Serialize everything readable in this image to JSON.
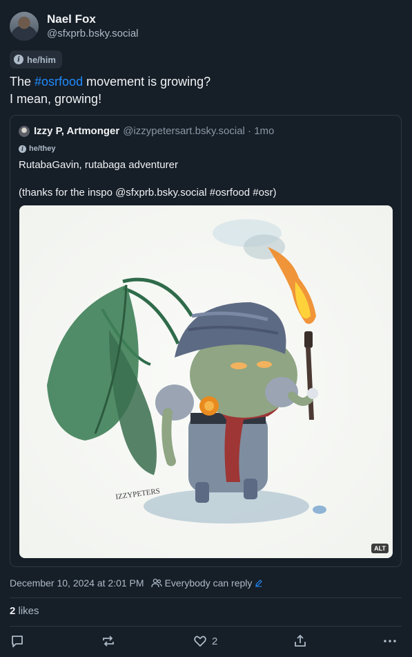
{
  "author": {
    "display_name": "Nael Fox",
    "handle": "@sfxprb.bsky.social",
    "pronouns": "he/him"
  },
  "post": {
    "text_before": "The ",
    "hashtag": "#osrfood",
    "text_after": " movement is growing?",
    "line2": "I mean, growing!"
  },
  "quote": {
    "display_name": "Izzy P, Artmonger",
    "handle_time": "@izzypetersart.bsky.social · 1mo",
    "pronouns": "he/they",
    "line1": "RutabaGavin, rutabaga adventurer",
    "line2": "",
    "line3": "(thanks for the inspo @sfxprb.bsky.social #osrfood #osr)",
    "image_alt_badge": "ALT",
    "signature": "IZZYPETERS"
  },
  "meta": {
    "timestamp": "December 10, 2024 at 2:01 PM",
    "reply_setting": "Everybody can reply"
  },
  "engagement": {
    "likes_count": "2",
    "likes_label": "likes",
    "like_action_count": "2"
  },
  "icons": {
    "reply": "reply-icon",
    "repost": "repost-icon",
    "like": "heart-icon",
    "share": "share-icon",
    "more": "more-icon",
    "people": "people-icon",
    "edit": "pencil-icon"
  },
  "colors": {
    "background": "#161e27",
    "accent": "#208bfe",
    "muted": "#aebbc9",
    "border": "#2e3845"
  }
}
